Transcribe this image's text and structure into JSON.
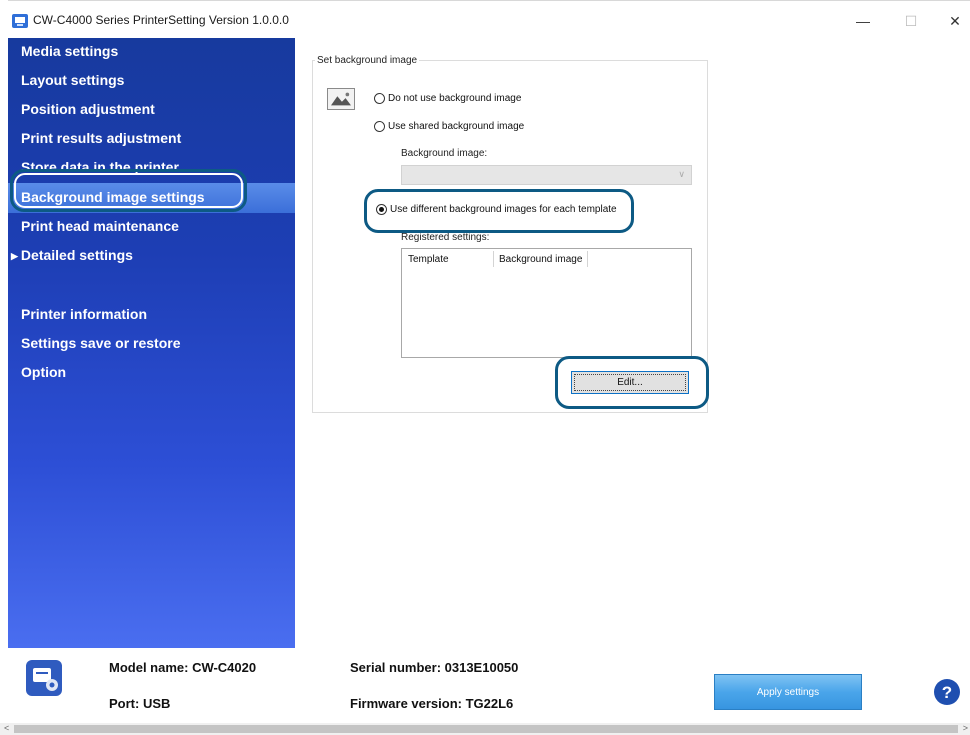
{
  "window": {
    "title": "CW-C4000 Series PrinterSetting Version 1.0.0.0",
    "minimize_glyph": "—",
    "maximize_glyph": "☐",
    "close_glyph": "✕"
  },
  "sidebar": {
    "items": [
      {
        "label": "Media settings"
      },
      {
        "label": "Layout settings"
      },
      {
        "label": "Position adjustment"
      },
      {
        "label": "Print results adjustment"
      },
      {
        "label": "Store data in the printer"
      },
      {
        "label": "Background image settings",
        "selected": true
      },
      {
        "label": "Print head maintenance"
      },
      {
        "label": "Detailed settings",
        "expand_glyph": "▶"
      },
      {
        "label": "Printer information"
      },
      {
        "label": "Settings save or restore"
      },
      {
        "label": "Option"
      }
    ]
  },
  "main": {
    "group_title": "Set background image",
    "image_icon": "image-placeholder-icon",
    "options": [
      {
        "label": "Do not use background image",
        "selected": false
      },
      {
        "label": "Use shared background image",
        "selected": false
      },
      {
        "label": "Use different background images for each template",
        "selected": true
      }
    ],
    "background_image_label": "Background image:",
    "background_image_value": "",
    "registered_label": "Registered settings:",
    "columns": [
      "Template",
      "Background image"
    ],
    "rows": [],
    "edit_button": "Edit..."
  },
  "footer": {
    "model_name": "Model name: CW-C4020",
    "port": "Port: USB",
    "serial": "Serial number: 0313E10050",
    "firmware": "Firmware version: TG22L6",
    "apply_button": "Apply settings",
    "help_icon": "help-icon"
  },
  "colors": {
    "sidebar_top": "#173a9e",
    "sidebar_bottom": "#4a6ef0",
    "selected": "#3b6fd9",
    "callout": "#0d5a84",
    "apply_button": "#4aa5ea"
  }
}
